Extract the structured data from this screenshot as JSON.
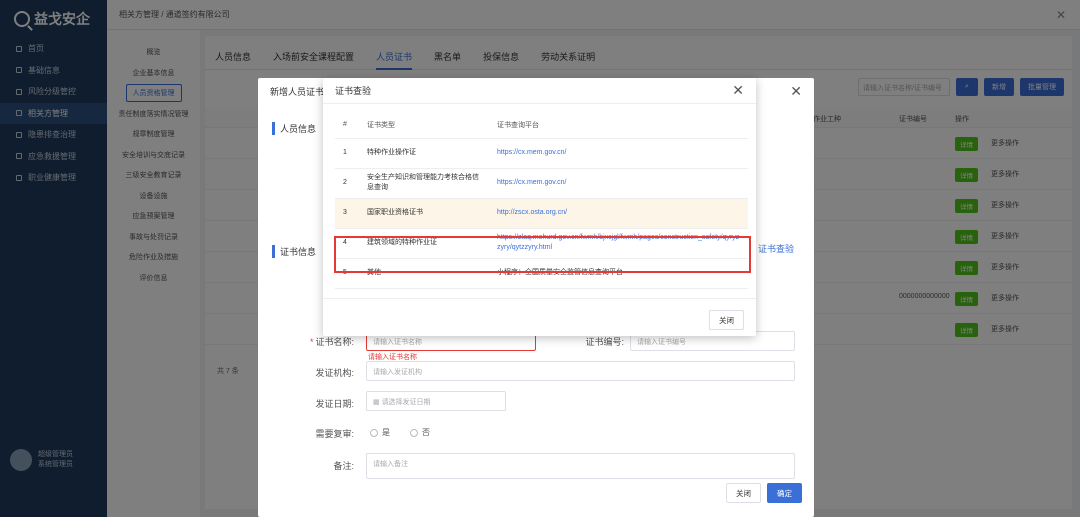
{
  "sidebar": {
    "brand": "益戈安企",
    "items": [
      {
        "label": "首页"
      },
      {
        "label": "基础信息"
      },
      {
        "label": "风险分级管控"
      },
      {
        "label": "相关方管理"
      },
      {
        "label": "隐患排查治理"
      },
      {
        "label": "应急救援管理"
      },
      {
        "label": "职业健康管理"
      }
    ],
    "user": {
      "name": "超级管理员",
      "role": "系统管理员"
    }
  },
  "topbar": {
    "breadcrumb": "相关方管理 / 通道签约有限公司"
  },
  "submenu": {
    "items": [
      {
        "label": "概览",
        "active": false
      },
      {
        "label": "企业基本信息",
        "active": false
      },
      {
        "label": "人员资格管理",
        "active": true
      },
      {
        "label": "责任制度落实情况管理",
        "active": false
      },
      {
        "label": "规章制度管理",
        "active": false
      },
      {
        "label": "安全培训与交底记录",
        "active": false
      },
      {
        "label": "三级安全教育记录",
        "active": false
      },
      {
        "label": "设备设施",
        "active": false
      },
      {
        "label": "应急预案管理",
        "active": false
      },
      {
        "label": "事故与处罚记录",
        "active": false
      },
      {
        "label": "危险作业及措施",
        "active": false
      },
      {
        "label": "评价信息",
        "active": false
      }
    ]
  },
  "tabs": [
    {
      "label": "人员信息",
      "active": false
    },
    {
      "label": "入场前安全课程配置",
      "active": false
    },
    {
      "label": "人员证书",
      "active": true
    },
    {
      "label": "黑名单",
      "active": false
    },
    {
      "label": "投保信息",
      "active": false
    },
    {
      "label": "劳动关系证明",
      "active": false
    }
  ],
  "toolbar": {
    "search_placeholder": "请输入证书名称/证书编号",
    "add_label": "新增",
    "batch_label": "批量管理"
  },
  "table": {
    "headers": [
      "作业工种",
      "证书编号",
      "操作"
    ],
    "rows": [
      {
        "status": "详情",
        "more": "更多操作",
        "num": ""
      },
      {
        "status": "详情",
        "more": "更多操作",
        "num": ""
      },
      {
        "status": "详情",
        "more": "更多操作",
        "num": ""
      },
      {
        "status": "详情",
        "more": "更多操作",
        "num": ""
      },
      {
        "status": "详情",
        "more": "更多操作",
        "num": ""
      },
      {
        "status": "详情",
        "more": "更多操作",
        "num": "0000000000000"
      },
      {
        "status": "详情",
        "more": "更多操作",
        "num": ""
      }
    ],
    "total": "共 7 条"
  },
  "back_dialog": {
    "title": "新增人员证书",
    "section_person": "人员信息",
    "section_cert": "证书信息",
    "cert_query_link": "证书查验",
    "fields": {
      "cert_name_label": "证书名称:",
      "cert_name_placeholder": "请输入证书名称",
      "cert_name_error": "请输入证书名称",
      "cert_no_label": "证书编号:",
      "cert_no_placeholder": "请输入证书编号",
      "issuer_label": "发证机构:",
      "issuer_placeholder": "请输入发证机构",
      "issue_date_label": "发证日期:",
      "issue_date_placeholder": "请选择发证日期",
      "review_label": "需要复审:",
      "review_yes": "是",
      "review_no": "否",
      "remark_label": "备注:",
      "remark_placeholder": "请输入备注"
    },
    "cancel_label": "关闭",
    "ok_label": "确定"
  },
  "cert_dialog": {
    "title": "证书查验",
    "headers": [
      "#",
      "证书类型",
      "证书查询平台"
    ],
    "rows": [
      {
        "idx": "1",
        "type": "特种作业操作证",
        "url": "https://cx.mem.gov.cn/"
      },
      {
        "idx": "2",
        "type": "安全生产知识和管理能力考核合格信息查询",
        "url": "https://cx.mem.gov.cn/"
      },
      {
        "idx": "3",
        "type": "国家职业资格证书",
        "url": "http://zscx.osta.org.cn/"
      },
      {
        "idx": "4",
        "type": "建筑领域的特种作业证",
        "url": "https://zlaq.mohurd.gov.cn/fwmh/bjxcjgl/fwmh/pages/construction_safety/qyryzzyry/qytzzyry.html"
      },
      {
        "idx": "5",
        "type": "其他",
        "url": "小程序：全国质量安全监管信息查询平台"
      }
    ],
    "close_label": "关闭"
  }
}
